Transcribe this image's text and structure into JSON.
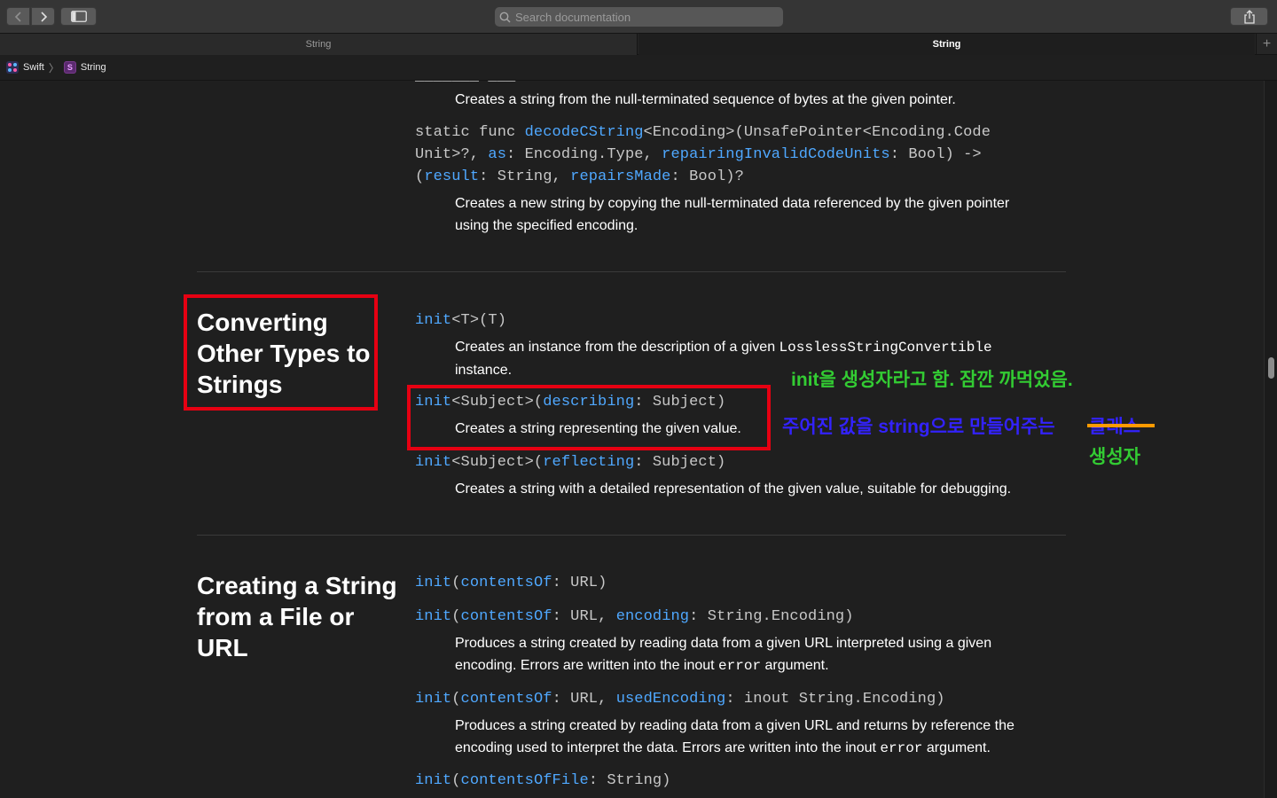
{
  "toolbar": {
    "search_placeholder": "Search documentation"
  },
  "tabs": [
    {
      "label": "String"
    },
    {
      "label": "String"
    }
  ],
  "breadcrumb": {
    "items": [
      "Swift",
      "String"
    ]
  },
  "content": {
    "top_fragment": {
      "desc1": "Creates a string from the null-terminated sequence of bytes at the given pointer.",
      "sig_line1_pre": "static func ",
      "sig_line1_name": "decodeCString",
      "sig_line1_post": "<Encoding>(UnsafePointer<Encoding.Code",
      "sig_line2_a": "Unit>?, ",
      "sig_line2_b": "as",
      "sig_line2_c": ": Encoding.Type, ",
      "sig_line2_d": "repairingInvalidCodeUnits",
      "sig_line2_e": ": Bool) ->",
      "sig_line3_a": "(",
      "sig_line3_b": "result",
      "sig_line3_c": ": String, ",
      "sig_line3_d": "repairsMade",
      "sig_line3_e": ": Bool)?",
      "desc2_line1": "Creates a new string by copying the null-terminated data referenced by the given pointer",
      "desc2_line2": "using the specified encoding."
    },
    "converting": {
      "title_lines": [
        "Converting",
        "Other Types to",
        "Strings"
      ],
      "item1_kw": "init",
      "item1_rest": "<T>(T)",
      "item1_desc_a": "Creates an instance from the description of a given ",
      "item1_desc_code": "LosslessStringConvertible",
      "item1_desc_line2": "instance.",
      "item2_kw": "init",
      "item2_a": "<Subject>(",
      "item2_param": "describing",
      "item2_b": ": Subject)",
      "item2_desc": "Creates a string representing the given value.",
      "item3_kw": "init",
      "item3_a": "<Subject>(",
      "item3_param": "reflecting",
      "item3_b": ": Subject)",
      "item3_desc": "Creates a string with a detailed representation of the given value, suitable for debugging."
    },
    "creating": {
      "title_lines": [
        "Creating a String",
        "from a File or",
        "URL"
      ],
      "i1_kw": "init",
      "i1_a": "(",
      "i1_param": "contentsOf",
      "i1_b": ": URL)",
      "i2_kw": "init",
      "i2_a": "(",
      "i2_param": "contentsOf",
      "i2_b": ": URL, ",
      "i2_param2": "encoding",
      "i2_c": ": String.Encoding)",
      "i2_desc_line1": "Produces a string created by reading data from a given URL interpreted using a given",
      "i2_desc_line2_a": "encoding. Errors are written into the inout ",
      "i2_desc_code": "error",
      "i2_desc_line2_b": " argument.",
      "i3_kw": "init",
      "i3_a": "(",
      "i3_param": "contentsOf",
      "i3_b": ": URL, ",
      "i3_param2": "usedEncoding",
      "i3_c": ": inout String.Encoding)",
      "i3_desc_line1": "Produces a string created by reading data from a given URL and returns by reference the",
      "i3_desc_line2_a": "encoding used to interpret the data. Errors are written into the inout ",
      "i3_desc_code": "error",
      "i3_desc_line2_b": " argument.",
      "i4_kw": "init",
      "i4_a": "(",
      "i4_param": "contentsOfFile",
      "i4_b": ": String)"
    }
  },
  "annotations": {
    "green_note": "init을 생성자라고 함. 잠깐 까먹었음.",
    "blue_note": "주어진 값을 string으로 만들어주는",
    "struck_word": "클래스",
    "correction": "생성자",
    "colors": {
      "box": "#e60012",
      "green": "#33cc33",
      "blue": "#3322ff",
      "strike": "#ff9a00"
    }
  }
}
